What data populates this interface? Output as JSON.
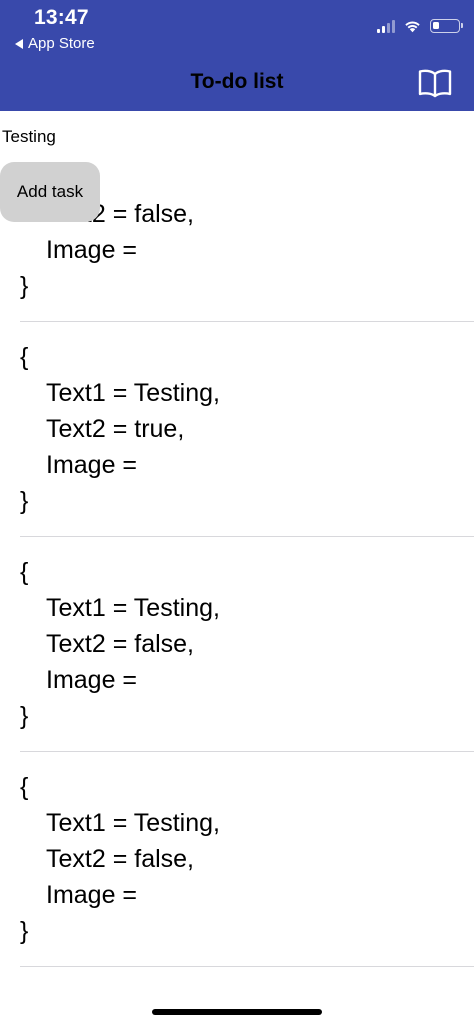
{
  "status_bar": {
    "time": "13:47",
    "back_label": "App Store",
    "battery_level": 0.25
  },
  "nav": {
    "title": "To-do list",
    "icon": "book-icon"
  },
  "input_text": "Testing",
  "add_button_label": "Add task",
  "partial_item": {
    "text2_line": "Text2 = false,",
    "image_line": "Image =",
    "close_brace": "}"
  },
  "items": [
    {
      "open_brace": "{",
      "text1_line": "Text1 = Testing,",
      "text2_line": "Text2 = true,",
      "image_line": "Image =",
      "close_brace": "}"
    },
    {
      "open_brace": "{",
      "text1_line": "Text1 = Testing,",
      "text2_line": "Text2 = false,",
      "image_line": "Image =",
      "close_brace": "}"
    },
    {
      "open_brace": "{",
      "text1_line": "Text1 = Testing,",
      "text2_line": "Text2 = false,",
      "image_line": "Image =",
      "close_brace": "}"
    }
  ],
  "colors": {
    "header_bg": "#3949AB",
    "button_bg": "#D1D1D1",
    "divider": "#D8D8DC"
  }
}
